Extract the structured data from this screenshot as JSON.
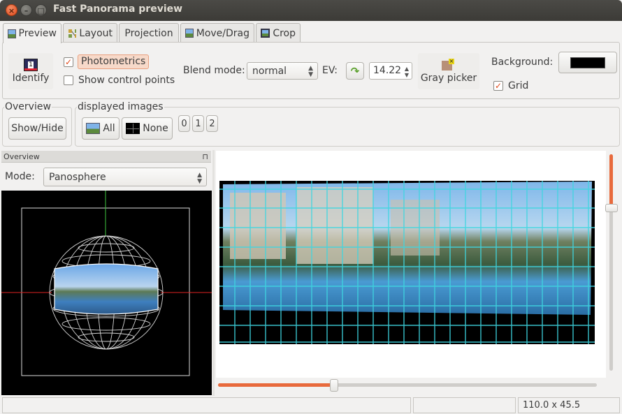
{
  "window": {
    "title": "Fast Panorama preview"
  },
  "tabs": [
    {
      "label": "Preview",
      "icon": "picture-icon",
      "active": true
    },
    {
      "label": "Layout",
      "icon": "layout-icon"
    },
    {
      "label": "Projection",
      "icon": ""
    },
    {
      "label": "Move/Drag",
      "icon": "picture-icon"
    },
    {
      "label": "Crop",
      "icon": "crop-icon"
    }
  ],
  "toolbar": {
    "identify_label": "Identify",
    "photometrics_label": "Photometrics",
    "photometrics_checked": true,
    "show_cp_label": "Show control points",
    "show_cp_checked": false,
    "blend_mode_label": "Blend mode:",
    "blend_mode_value": "normal",
    "ev_label": "EV:",
    "ev_value": "14.22",
    "gray_picker_label": "Gray picker",
    "background_label": "Background:",
    "background_color": "#000000",
    "grid_label": "Grid",
    "grid_checked": true
  },
  "overview_group": {
    "title": "Overview",
    "show_hide_label": "Show/Hide"
  },
  "displayed_images": {
    "title": "displayed images",
    "all_label": "All",
    "none_label": "None",
    "image_numbers": [
      "0",
      "1",
      "2"
    ]
  },
  "overview_panel": {
    "title": "Overview",
    "mode_label": "Mode:",
    "mode_value": "Panosphere"
  },
  "preview": {
    "slider_h_value": 0.38,
    "slider_v_value": 0.17
  },
  "statusbar": {
    "left": "",
    "middle": "",
    "right": "110.0 x 45.5"
  },
  "colors": {
    "accent": "#e0491b",
    "grid": "#3fd6e0",
    "titlebar": "#3c3b37"
  }
}
